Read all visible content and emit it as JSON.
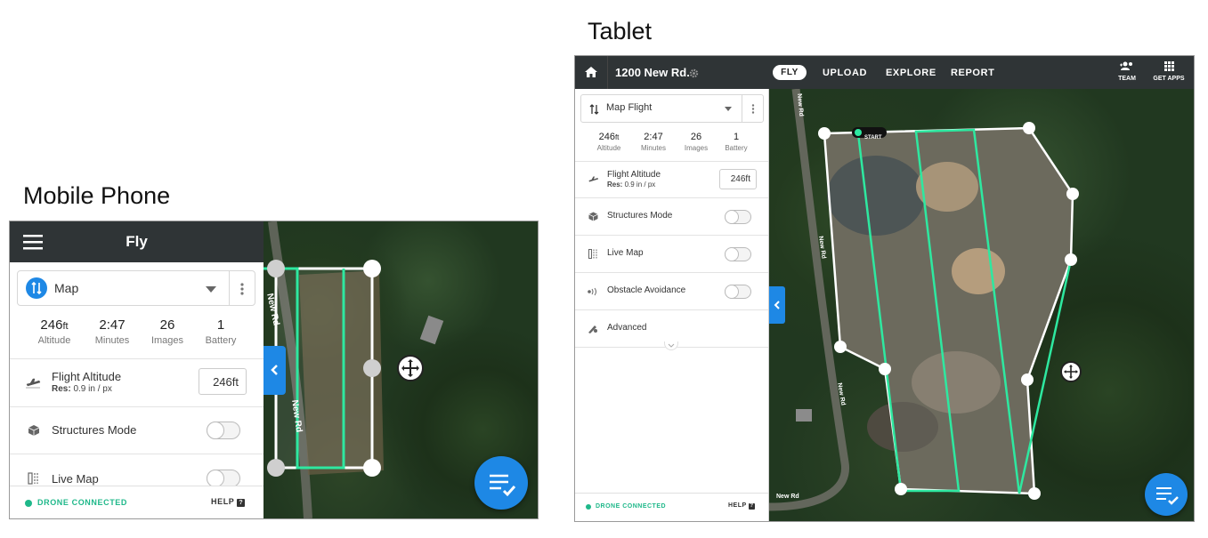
{
  "headings": {
    "phone": "Mobile Phone",
    "tablet": "Tablet"
  },
  "colors": {
    "accent_blue": "#1e88e5",
    "flight_green": "#2ee8a0",
    "header_dark": "#2f3436",
    "status_green": "#1fb88a"
  },
  "phone": {
    "header_title": "Fly",
    "mode_label": "Map",
    "stats": [
      {
        "value": "246",
        "unit": "ft",
        "label": "Altitude"
      },
      {
        "value": "2:47",
        "unit": "",
        "label": "Minutes"
      },
      {
        "value": "26",
        "unit": "",
        "label": "Images"
      },
      {
        "value": "1",
        "unit": "",
        "label": "Battery"
      }
    ],
    "flight_altitude": {
      "label": "Flight Altitude",
      "res_prefix": "Res:",
      "res_value": "0.9 in / px",
      "value": "246ft"
    },
    "settings": [
      {
        "label": "Structures Mode",
        "on": false
      },
      {
        "label": "Live Map",
        "on": false
      }
    ],
    "status": "DRONE CONNECTED",
    "help": "HELP",
    "map_labels": [
      "New Rd",
      "New Rd"
    ]
  },
  "tablet": {
    "project": "1200 New Rd.",
    "nav_tabs": [
      {
        "label": "FLY",
        "active": true
      },
      {
        "label": "UPLOAD",
        "active": false
      },
      {
        "label": "EXPLORE",
        "active": false
      },
      {
        "label": "REPORT",
        "active": false
      }
    ],
    "right_actions": [
      "TEAM",
      "GET APPS"
    ],
    "mode_label": "Map Flight",
    "stats": [
      {
        "value": "246",
        "unit": "ft",
        "label": "Altitude"
      },
      {
        "value": "2:47",
        "unit": "",
        "label": "Minutes"
      },
      {
        "value": "26",
        "unit": "",
        "label": "Images"
      },
      {
        "value": "1",
        "unit": "",
        "label": "Battery"
      }
    ],
    "flight_altitude": {
      "label": "Flight Altitude",
      "res_prefix": "Res:",
      "res_value": "0.9 in / px",
      "value": "246ft"
    },
    "settings": [
      {
        "label": "Structures Mode",
        "on": false
      },
      {
        "label": "Live Map",
        "on": false
      },
      {
        "label": "Obstacle Avoidance",
        "on": false
      }
    ],
    "advanced": "Advanced",
    "status": "DRONE CONNECTED",
    "help": "HELP",
    "start_label": "START",
    "map_labels": [
      "New Rd",
      "New Rd",
      "New Rd",
      "New Rd"
    ]
  }
}
